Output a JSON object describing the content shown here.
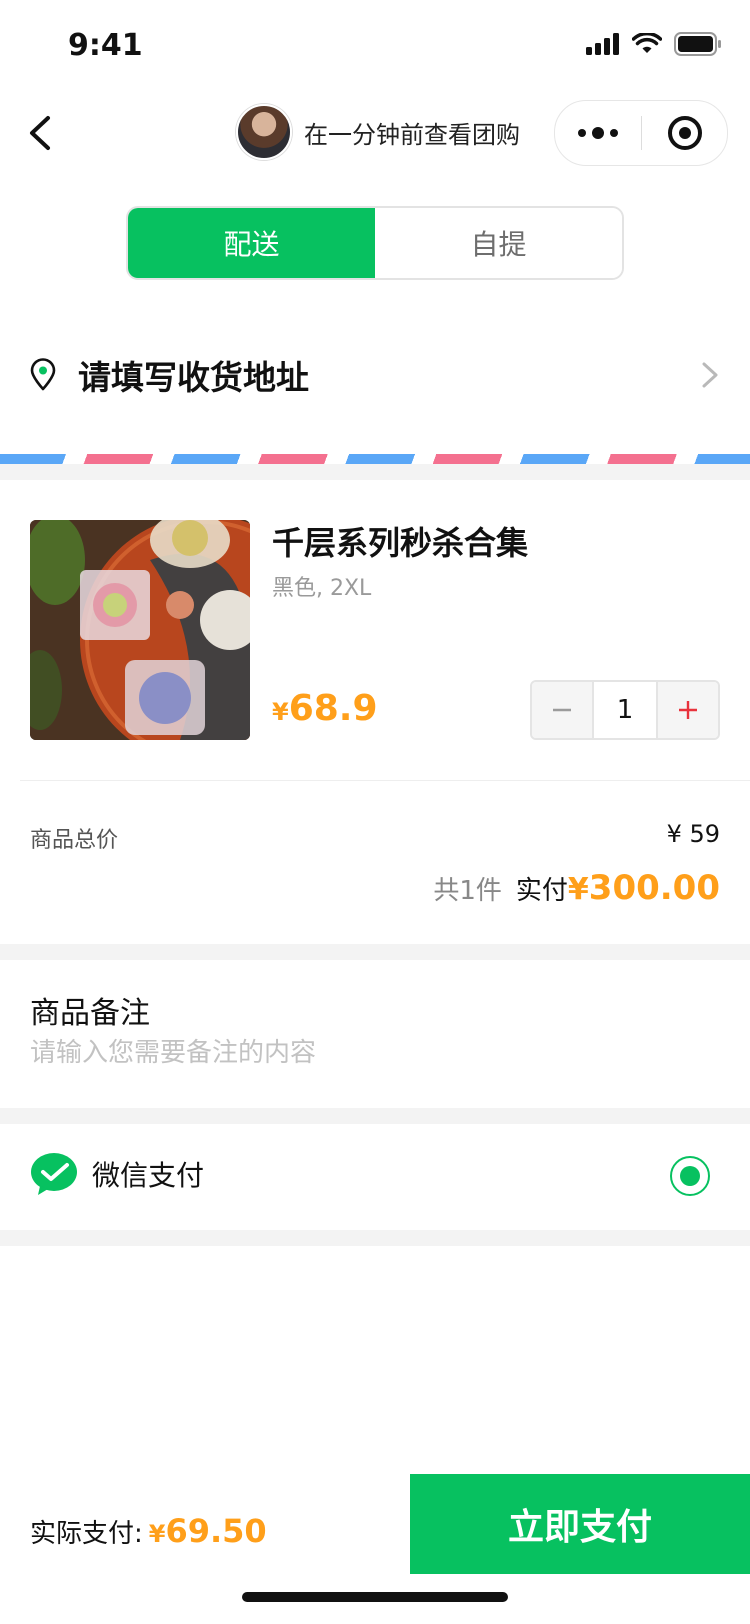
{
  "status": {
    "time": "9:41"
  },
  "nav": {
    "title": "在一分钟前查看团购"
  },
  "tabs": [
    {
      "label": "配送",
      "active": true
    },
    {
      "label": "自提",
      "active": false
    }
  ],
  "address": {
    "placeholder": "请填写收货地址"
  },
  "product": {
    "title": "千层系列秒杀合集",
    "sku": "黑色, 2XL",
    "price_symbol": "¥",
    "price": "68.9",
    "quantity": "1"
  },
  "summary": {
    "total_label": "商品总价",
    "total_value": "¥ 59",
    "count_text": "共1件",
    "paid_label": "实付",
    "paid_symbol": "¥",
    "paid_amount": "300.00"
  },
  "note": {
    "title": "商品备注",
    "placeholder": "请输入您需要备注的内容"
  },
  "payment": {
    "method": "微信支付",
    "selected": true
  },
  "bottom": {
    "label": "实际支付:",
    "symbol": "¥",
    "amount": "69.50",
    "button": "立即支付"
  },
  "colors": {
    "brand_green": "#07c160",
    "price_orange": "#ff9f1a",
    "plus_red": "#e8323c"
  },
  "icons": [
    "back-arrow-icon",
    "more-dots-icon",
    "target-icon",
    "location-pin-icon",
    "chevron-right-icon",
    "wechat-icon"
  ]
}
